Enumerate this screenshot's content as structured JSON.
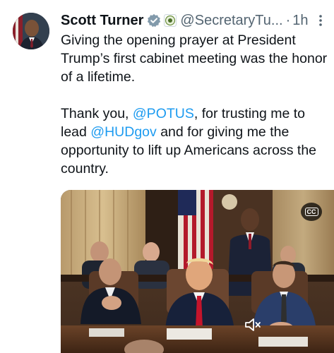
{
  "tweet": {
    "author_name": "Scott Turner",
    "handle": "@SecretaryTu...",
    "separator": "·",
    "time": "1h",
    "paragraph1": "Giving the opening prayer at President Trump’s first cabinet meeting was the honor of a lifetime.",
    "para2_part1": "Thank you, ",
    "mention_potus": "@POTUS",
    "para2_part2": ", for trusting me to lead ",
    "mention_hud": "@HUDgov",
    "para2_part3": " and for giving me the opportunity to lift up Americans across the country."
  },
  "video": {
    "cc_label": "CC"
  },
  "icons": {
    "verified": "verified-badge-icon",
    "affiliation": "government-seal-icon",
    "more": "more-options-icon",
    "captions": "closed-captions-icon",
    "muted": "speaker-muted-icon"
  },
  "colors": {
    "link": "#1d9bf0",
    "secondary_text": "#536471",
    "primary_text": "#0f1419"
  }
}
